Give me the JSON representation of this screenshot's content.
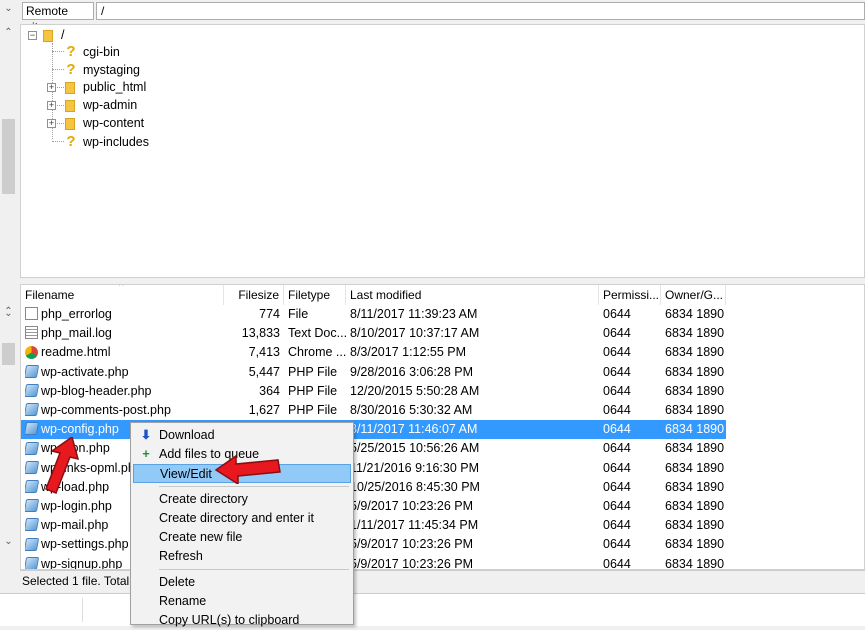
{
  "remote_site": {
    "label": "Remote site:",
    "path": "/"
  },
  "tree": {
    "root": "/",
    "items": [
      {
        "name": "cgi-bin",
        "type": "unknown"
      },
      {
        "name": "mystaging",
        "type": "unknown"
      },
      {
        "name": "public_html",
        "type": "folder"
      },
      {
        "name": "wp-admin",
        "type": "folder"
      },
      {
        "name": "wp-content",
        "type": "folder"
      },
      {
        "name": "wp-includes",
        "type": "unknown"
      }
    ]
  },
  "columns": {
    "filename": "Filename",
    "filesize": "Filesize",
    "filetype": "Filetype",
    "modified": "Last modified",
    "perms": "Permissi...",
    "owner": "Owner/G..."
  },
  "files": [
    {
      "name": "php_errorlog",
      "size": "774",
      "type": "File",
      "modified": "8/11/2017 11:39:23 AM",
      "perms": "0644",
      "owner": "6834 1890",
      "icon": "doc-icon"
    },
    {
      "name": "php_mail.log",
      "size": "13,833",
      "type": "Text Doc...",
      "modified": "8/10/2017 10:37:17 AM",
      "perms": "0644",
      "owner": "6834 1890",
      "icon": "log-icon"
    },
    {
      "name": "readme.html",
      "size": "7,413",
      "type": "Chrome ...",
      "modified": "8/3/2017 1:12:55 PM",
      "perms": "0644",
      "owner": "6834 1890",
      "icon": "chrome-icon"
    },
    {
      "name": "wp-activate.php",
      "size": "5,447",
      "type": "PHP File",
      "modified": "9/28/2016 3:06:28 PM",
      "perms": "0644",
      "owner": "6834 1890",
      "icon": "php-icon"
    },
    {
      "name": "wp-blog-header.php",
      "size": "364",
      "type": "PHP File",
      "modified": "12/20/2015 5:50:28 AM",
      "perms": "0644",
      "owner": "6834 1890",
      "icon": "php-icon"
    },
    {
      "name": "wp-comments-post.php",
      "size": "1,627",
      "type": "PHP File",
      "modified": "8/30/2016 5:30:32 AM",
      "perms": "0644",
      "owner": "6834 1890",
      "icon": "php-icon"
    },
    {
      "name": "wp-config.php",
      "size": "",
      "type": "",
      "modified": "8/11/2017 11:46:07 AM",
      "perms": "0644",
      "owner": "6834 1890",
      "icon": "php-icon",
      "selected": true
    },
    {
      "name": "wp-cron.php",
      "size": "",
      "type": "",
      "modified": "5/25/2015 10:56:26 AM",
      "perms": "0644",
      "owner": "6834 1890",
      "icon": "php-icon"
    },
    {
      "name": "wp-links-opml.php",
      "size": "",
      "type": "",
      "modified": "11/21/2016 9:16:30 PM",
      "perms": "0644",
      "owner": "6834 1890",
      "icon": "php-icon"
    },
    {
      "name": "wp-load.php",
      "size": "",
      "type": "",
      "modified": "10/25/2016 8:45:30 PM",
      "perms": "0644",
      "owner": "6834 1890",
      "icon": "php-icon"
    },
    {
      "name": "wp-login.php",
      "size": "",
      "type": "",
      "modified": "5/9/2017 10:23:26 PM",
      "perms": "0644",
      "owner": "6834 1890",
      "icon": "php-icon"
    },
    {
      "name": "wp-mail.php",
      "size": "",
      "type": "",
      "modified": "1/11/2017 11:45:34 PM",
      "perms": "0644",
      "owner": "6834 1890",
      "icon": "php-icon"
    },
    {
      "name": "wp-settings.php",
      "size": "",
      "type": "",
      "modified": "5/9/2017 10:23:26 PM",
      "perms": "0644",
      "owner": "6834 1890",
      "icon": "php-icon"
    },
    {
      "name": "wp-signup.php",
      "size": "",
      "type": "",
      "modified": "5/9/2017 10:23:26 PM",
      "perms": "0644",
      "owner": "6834 1890",
      "icon": "php-icon"
    }
  ],
  "status": "Selected 1 file. Total",
  "context_menu": {
    "items": [
      {
        "label": "Download",
        "icon": "download-icon"
      },
      {
        "label": "Add files to queue",
        "icon": "add-queue-icon"
      },
      {
        "label": "View/Edit",
        "highlighted": true
      },
      {
        "sep": true
      },
      {
        "label": "Create directory"
      },
      {
        "label": "Create directory and enter it"
      },
      {
        "label": "Create new file"
      },
      {
        "label": "Refresh"
      },
      {
        "sep": true
      },
      {
        "label": "Delete"
      },
      {
        "label": "Rename"
      },
      {
        "label": "Copy URL(s) to clipboard"
      }
    ]
  },
  "colors": {
    "selection": "#3399ff",
    "menu_highlight": "#91c9f7",
    "annotation_arrow": "#e8181f"
  }
}
